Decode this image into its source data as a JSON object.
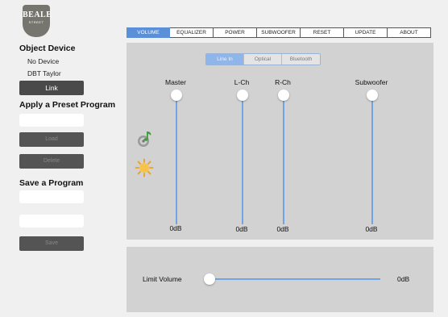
{
  "logo": {
    "text": "BEALE",
    "subtext": "STREET"
  },
  "sidebar": {
    "object_device": "Object Device",
    "device_none": "No Device",
    "device_name": "DBT Taylor",
    "link": "Link",
    "apply_preset": "Apply a Preset Program",
    "load": "Load",
    "delete": "Delete",
    "save_program": "Save a Program",
    "save": "Save"
  },
  "tabs": [
    {
      "label": "VOLUME",
      "active": true
    },
    {
      "label": "EQUALIZER"
    },
    {
      "label": "POWER"
    },
    {
      "label": "SUBWOOFER"
    },
    {
      "label": "RESET"
    },
    {
      "label": "UPDATE"
    },
    {
      "label": "ABOUT"
    }
  ],
  "inputs": [
    {
      "label": "Line In",
      "active": true
    },
    {
      "label": "Optical"
    },
    {
      "label": "Bluetooth"
    }
  ],
  "sliders": [
    {
      "label": "Master",
      "value": "0dB"
    },
    {
      "label": "L-Ch",
      "value": "0dB"
    },
    {
      "label": "R-Ch",
      "value": "0dB"
    },
    {
      "label": "Subwoofer",
      "value": "0dB"
    }
  ],
  "limit": {
    "label": "Limit Volume",
    "value": "0dB"
  },
  "icons": {
    "music": "music-disc-icon",
    "sun": "sun-icon"
  },
  "colors": {
    "accent": "#5b8fd8",
    "track": "#6fa4e6",
    "panel": "#d2d2d2",
    "button": "#4a4a4a"
  }
}
